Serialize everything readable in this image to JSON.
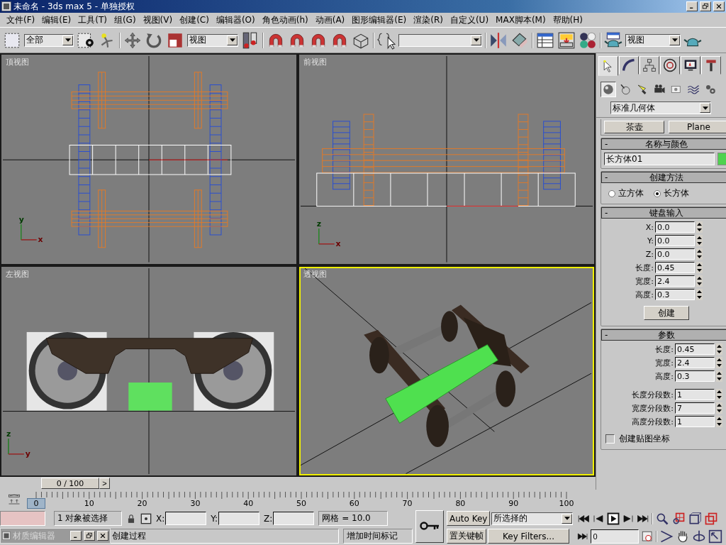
{
  "window": {
    "title": "未命名 - 3ds max 5 - 单独授权"
  },
  "menu": [
    "文件(F)",
    "编辑(E)",
    "工具(T)",
    "组(G)",
    "视图(V)",
    "创建(C)",
    "编辑器(O)",
    "角色动画(h)",
    "动画(A)",
    "图形编辑器(E)",
    "渲染(R)",
    "自定义(U)",
    "MAX脚本(M)",
    "帮助(H)"
  ],
  "toolbar": {
    "selection_filter": "全部",
    "reference_coordinate": "视图",
    "render_type": "视图"
  },
  "viewports": [
    {
      "label": "顶视图",
      "kind": "top",
      "active": false,
      "axes": {
        "up": "y",
        "right": "x"
      }
    },
    {
      "label": "前视图",
      "kind": "front",
      "active": false,
      "axes": {
        "up": "z",
        "right": "x"
      }
    },
    {
      "label": "左视图",
      "kind": "left",
      "active": false,
      "axes": {
        "up": "z",
        "right": "y"
      }
    },
    {
      "label": "透视图",
      "kind": "perspective",
      "active": true
    }
  ],
  "time_slider": {
    "label": "0 / 100",
    "next": ">",
    "level": 0
  },
  "track_bar": {
    "ticks": [
      {
        "label": "0",
        "current": true
      },
      {
        "label": "10",
        "current": false
      },
      {
        "label": "20",
        "current": false
      },
      {
        "label": "30",
        "current": false
      },
      {
        "label": "40",
        "current": false
      },
      {
        "label": "50",
        "current": false
      },
      {
        "label": "60",
        "current": false
      },
      {
        "label": "70",
        "current": false
      },
      {
        "label": "80",
        "current": false
      },
      {
        "label": "90",
        "current": false
      },
      {
        "label": "100",
        "current": false
      }
    ]
  },
  "command_panel": {
    "tabs": [
      {
        "selected": true
      },
      {
        "selected": false
      },
      {
        "selected": false
      },
      {
        "selected": false
      },
      {
        "selected": false
      },
      {
        "selected": false
      }
    ],
    "categories": [
      {
        "selected": true
      },
      {
        "selected": false
      },
      {
        "selected": false
      },
      {
        "selected": false
      },
      {
        "selected": false
      },
      {
        "selected": false
      },
      {
        "selected": false
      }
    ],
    "object_type": "标准几何体",
    "object_buttons": [
      "茶壶",
      "Plane"
    ],
    "name_color": {
      "title": "名称与颜色",
      "collapse": "-",
      "name": "长方体01",
      "color": "#4fd24f"
    },
    "creation_method": {
      "title": "创建方法",
      "collapse": "-",
      "options": [
        {
          "label": "立方体",
          "selected": false
        },
        {
          "label": "长方体",
          "selected": true
        }
      ]
    },
    "keyboard_entry": {
      "title": "键盘输入",
      "collapse": "-",
      "fields": [
        {
          "label": "X:",
          "value": "0.0"
        },
        {
          "label": "Y:",
          "value": "0.0"
        },
        {
          "label": "Z:",
          "value": "0.0"
        },
        {
          "label": "长度:",
          "value": "0.45"
        },
        {
          "label": "宽度:",
          "value": "2.4"
        },
        {
          "label": "高度:",
          "value": "0.3"
        }
      ],
      "button": "创建"
    },
    "parameters": {
      "title": "参数",
      "collapse": "-",
      "fields": [
        {
          "label": "长度:",
          "value": "0.45"
        },
        {
          "label": "宽度:",
          "value": "2.4"
        },
        {
          "label": "高度:",
          "value": "0.3"
        },
        {
          "label": "长度分段数:",
          "value": "1"
        },
        {
          "label": "宽度分段数:",
          "value": "7"
        },
        {
          "label": "高度分段数:",
          "value": "1"
        }
      ],
      "checkbox": {
        "label": "创建贴图坐标",
        "checked": false
      }
    }
  },
  "status": {
    "selection": "1 对象被选择",
    "x_label": "X:",
    "y_label": "Y:",
    "z_label": "Z:",
    "grid": "网格 = 10.0",
    "prompt": "创建过程",
    "time_tag": "增加时间标记",
    "auto_key": "Auto Key",
    "key_set": "所选择的",
    "set_key": "置关键帧",
    "key_filters": "Key Filters...",
    "frame": "0"
  },
  "minimized_window": {
    "title": "材质编辑器"
  }
}
